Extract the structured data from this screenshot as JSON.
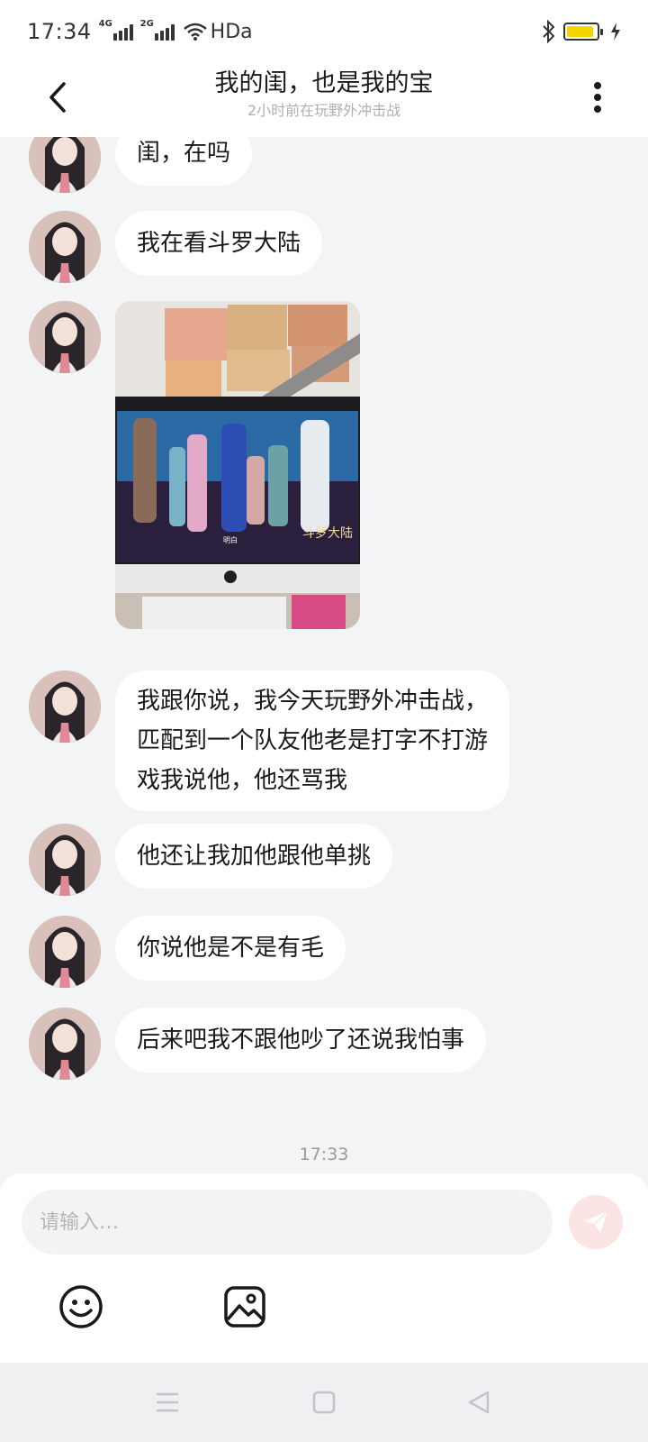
{
  "status_bar": {
    "time": "17:34",
    "network1": "4G",
    "network2": "2G",
    "hd_label": "HDa",
    "battery_level": 0.9,
    "battery_color": "#f5d400"
  },
  "header": {
    "title": "我的闺，也是我的宝",
    "subtitle": "2小时前在玩野外冲击战",
    "back_icon": "chevron-left-icon",
    "more_icon": "more-vertical-icon"
  },
  "messages": [
    {
      "type": "text",
      "text": "闺，在吗"
    },
    {
      "type": "text",
      "text": "我在看斗罗大陆"
    },
    {
      "type": "image",
      "caption": "明白",
      "watermark": "斗罗大陆"
    },
    {
      "type": "text",
      "text": "我跟你说，我今天玩野外冲击战，\n匹配到一个队友他老是打字不打游\n戏我说他，他还骂我"
    },
    {
      "type": "text",
      "text": "他还让我加他跟他单挑"
    },
    {
      "type": "text",
      "text": "你说他是不是有毛"
    },
    {
      "type": "text",
      "text": "后来吧我不跟他吵了还说我怕事"
    }
  ],
  "timestamp": "17:33",
  "input": {
    "placeholder": "请输入…",
    "send_icon": "send-icon",
    "send_color": "#f5a9a9"
  },
  "toolbar": {
    "emoji_icon": "emoji-icon",
    "image_icon": "image-icon"
  },
  "nav": {
    "menu_icon": "menu-icon",
    "home_icon": "home-square-icon",
    "back_icon": "back-triangle-icon"
  }
}
